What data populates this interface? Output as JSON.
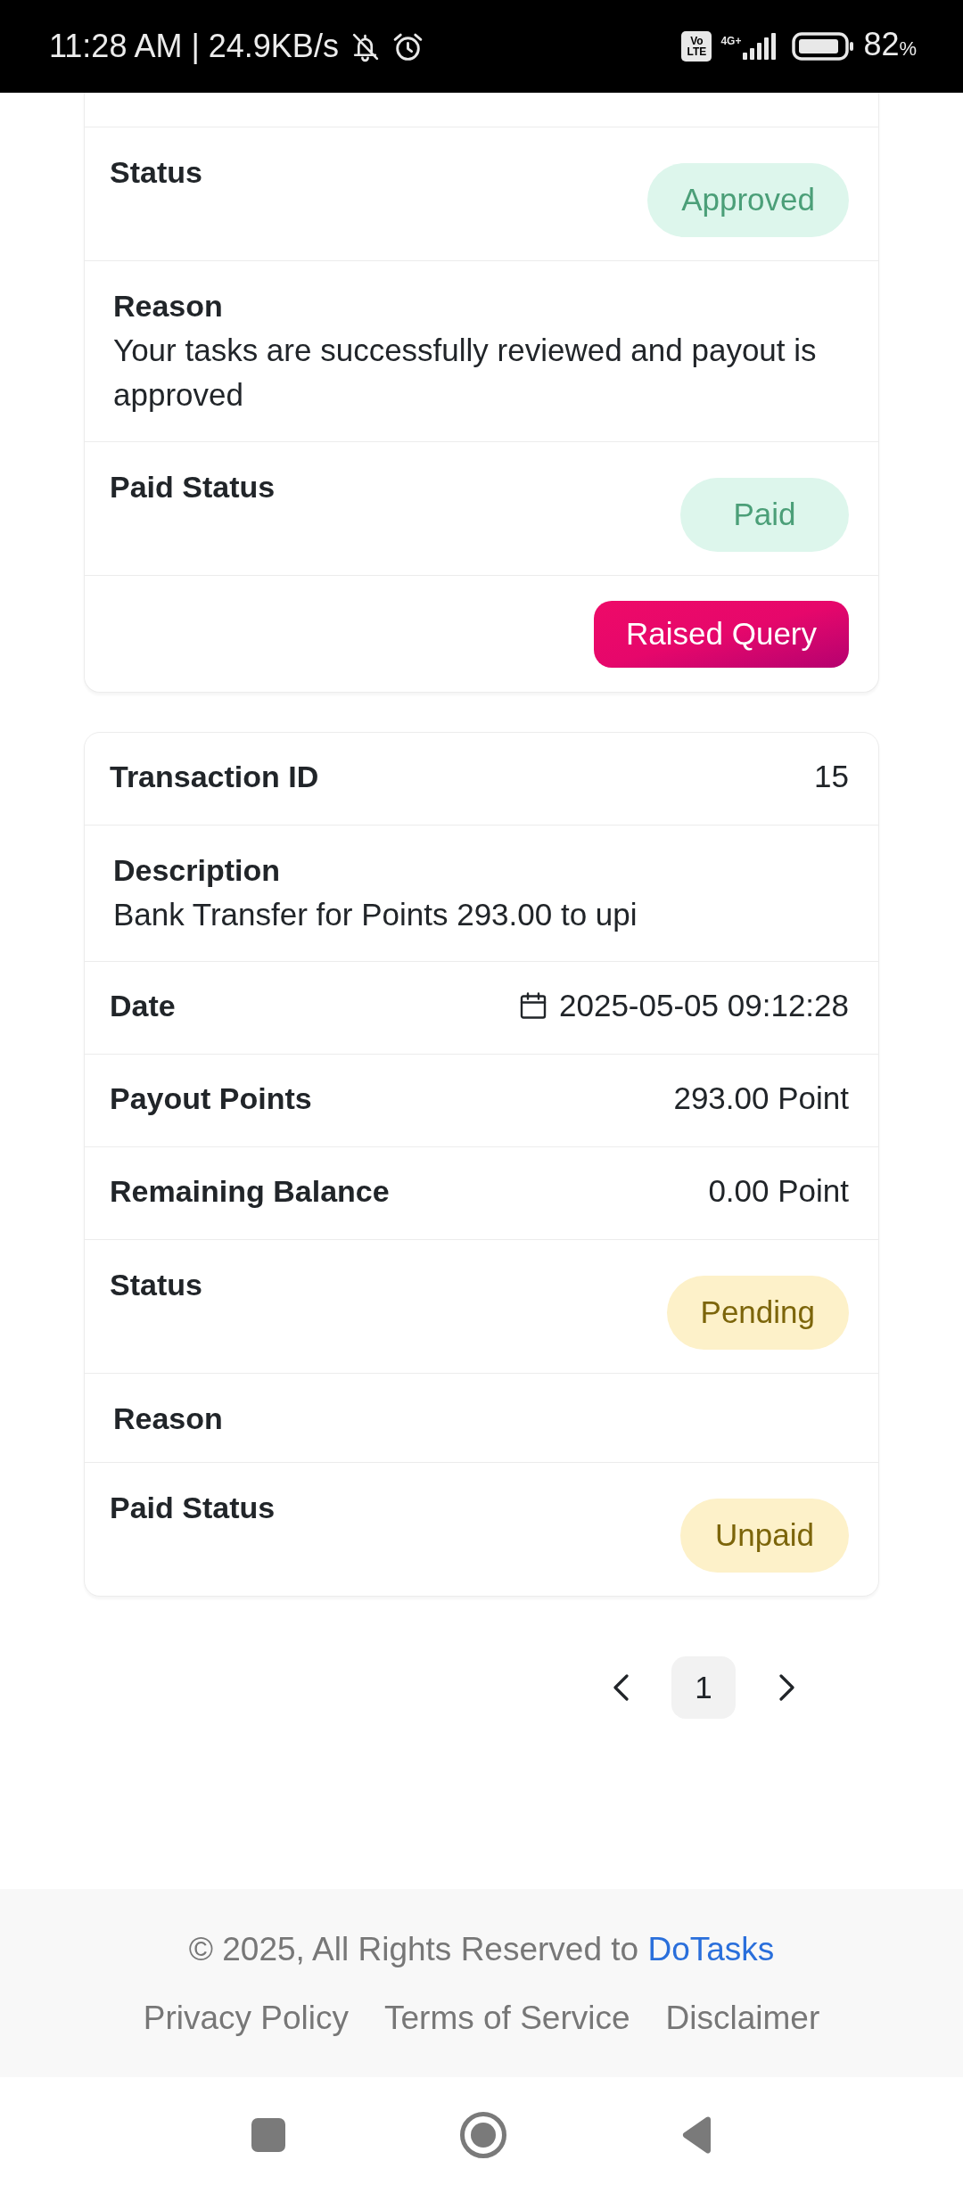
{
  "status_bar": {
    "time": "11:28 AM | 24.9KB/s",
    "volte_badge": [
      "Vo",
      "LTE"
    ],
    "network_type": "4G+",
    "battery": "82%"
  },
  "cards": [
    {
      "clipped_top": true,
      "rows": [
        {
          "kind": "badge",
          "label": "Status",
          "badge": {
            "text": "Approved",
            "kind": "success"
          }
        },
        {
          "kind": "note",
          "label": "Reason",
          "text": "Your tasks are successfully reviewed and payout is approved"
        },
        {
          "kind": "badge",
          "label": "Paid Status",
          "badge": {
            "text": "Paid",
            "kind": "success"
          }
        },
        {
          "kind": "action",
          "button": "Raised Query"
        }
      ]
    },
    {
      "clipped_top": false,
      "rows": [
        {
          "kind": "pair",
          "label": "Transaction ID",
          "value": "15"
        },
        {
          "kind": "note",
          "label": "Description",
          "text": "Bank Transfer for Points 293.00 to upi"
        },
        {
          "kind": "date",
          "label": "Date",
          "value": "2025-05-05 09:12:28"
        },
        {
          "kind": "pair",
          "label": "Payout Points",
          "value": "293.00 Point"
        },
        {
          "kind": "pair",
          "label": "Remaining Balance",
          "value": "0.00 Point"
        },
        {
          "kind": "badge",
          "label": "Status",
          "badge": {
            "text": "Pending",
            "kind": "warning"
          }
        },
        {
          "kind": "note",
          "label": "Reason"
        },
        {
          "kind": "badge",
          "label": "Paid Status",
          "badge": {
            "text": "Unpaid",
            "kind": "warning"
          }
        }
      ]
    }
  ],
  "pagination": {
    "pages": [
      {
        "label": "1",
        "selected": true
      }
    ]
  },
  "footer": {
    "copyright": "© 2025, All Rights Reserved to ",
    "brand_link": "DoTasks",
    "links": [
      "Privacy Policy",
      "Terms of Service",
      "Disclaimer"
    ]
  }
}
